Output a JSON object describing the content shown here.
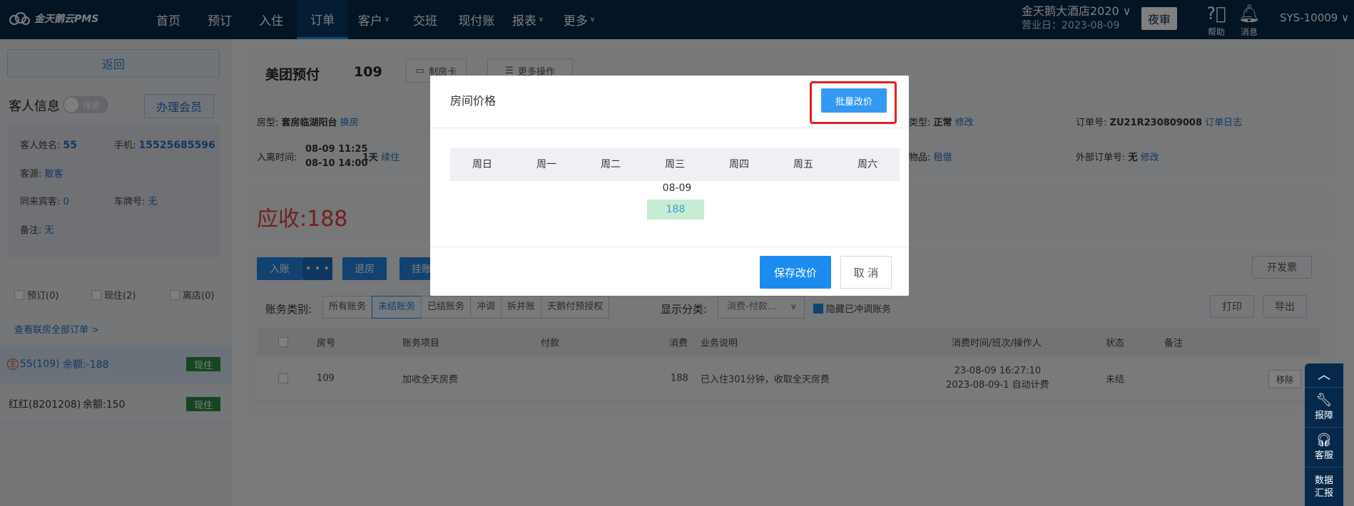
{
  "topbar": {
    "logo_text": "金天鹅云PMS",
    "nav": [
      {
        "label": "首页",
        "caret": ""
      },
      {
        "label": "预订",
        "caret": ""
      },
      {
        "label": "入住",
        "caret": ""
      },
      {
        "label": "订单",
        "caret": ""
      },
      {
        "label": "客户",
        "caret": "∨"
      },
      {
        "label": "交班",
        "caret": ""
      },
      {
        "label": "现付账",
        "caret": ""
      },
      {
        "label": "报表",
        "caret": "∨"
      },
      {
        "label": "更多",
        "caret": "∨"
      }
    ],
    "active_nav": "订单",
    "hotel_name": "金天鹅大酒店2020 ∨",
    "business_day": "营业日：2023-08-09",
    "night_audit": "夜审",
    "help": "帮助",
    "messages": "消息",
    "user": "SYS-10009 ∨"
  },
  "sidebar": {
    "back": "返回",
    "guest_info": "客人信息",
    "privacy_toggle": "保密",
    "member_btn": "办理会员",
    "fields": {
      "name_label": "客人姓名:",
      "name": "55",
      "phone_label": "手机:",
      "phone": "15525685596",
      "source_label": "客源:",
      "source": "散客",
      "companions_label": "同来宾客:",
      "companions": "0",
      "plate_label": "车牌号:",
      "plate": "无",
      "note_label": "备注:",
      "note": "无"
    },
    "tabs": [
      "预订(0)",
      "现住(2)",
      "离店(0)"
    ],
    "view_all": "查看联房全部订单 >",
    "rooms": [
      {
        "tag": "主",
        "text": "55(109)",
        "balance": "余额:-188",
        "status": "现住"
      },
      {
        "tag": "",
        "text": "红红(8201208)",
        "balance": "余额:150",
        "status": "现住"
      }
    ]
  },
  "order": {
    "source": "美团预付",
    "room_no": "109",
    "make_card": "制房卡",
    "more_ops": "更多操作",
    "room_type_label": "房型:",
    "room_type": "套房临湖阳台",
    "change_room": "换房",
    "checkin_label": "入离时间:",
    "checkin": "08-09 11:25",
    "checkout": "08-10 14:00",
    "nights": "1天",
    "extend": "续住",
    "price_type_label": "类型:",
    "price_type": "正常",
    "modify": "修改",
    "goods_label": "物品:",
    "goods": "租借",
    "order_no_label": "订单号:",
    "order_no": "ZU21R230809008",
    "order_log": "订单日志",
    "ext_no_label": "外部订单号:",
    "ext_no": "无",
    "ext_modify": "修改",
    "due_label": "应收:",
    "due": "188"
  },
  "actions": {
    "post": "入账",
    "more_dots": "• • •",
    "checkout": "退房",
    "hang": "挂账",
    "invoice": "开发票",
    "print": "打印",
    "export": "导出"
  },
  "filters": {
    "label": "账务类别:",
    "items": [
      "所有账务",
      "未结账务",
      "已结账务",
      "冲调",
      "拆并账",
      "天鹅付预授权"
    ],
    "active": "未结账务",
    "display_label": "显示分类:",
    "display_value": "消费-付款...",
    "hide_voided": "隐藏已冲调账务"
  },
  "table": {
    "headers": [
      "房号",
      "账务项目",
      "付款",
      "消费",
      "业务说明",
      "消费时间/班次/操作人",
      "状态",
      "备注"
    ],
    "rows": [
      {
        "room": "109",
        "item": "加收全天房费",
        "payment": "",
        "charge": "188",
        "desc": "已入住301分钟，收取全天房费",
        "time1": "23-08-09 16:27:10",
        "time2": "2023-08-09-1 自动计费",
        "status": "未结",
        "note": "",
        "action": "移除"
      }
    ]
  },
  "dock": [
    "报障",
    "客服",
    "数据汇报"
  ],
  "modal": {
    "title": "房间价格",
    "batch": "批量改价",
    "weekdays": [
      "周日",
      "周一",
      "周二",
      "周三",
      "周四",
      "周五",
      "周六"
    ],
    "date": "08-09",
    "price": "188",
    "save": "保存改价",
    "cancel": "取 消"
  }
}
